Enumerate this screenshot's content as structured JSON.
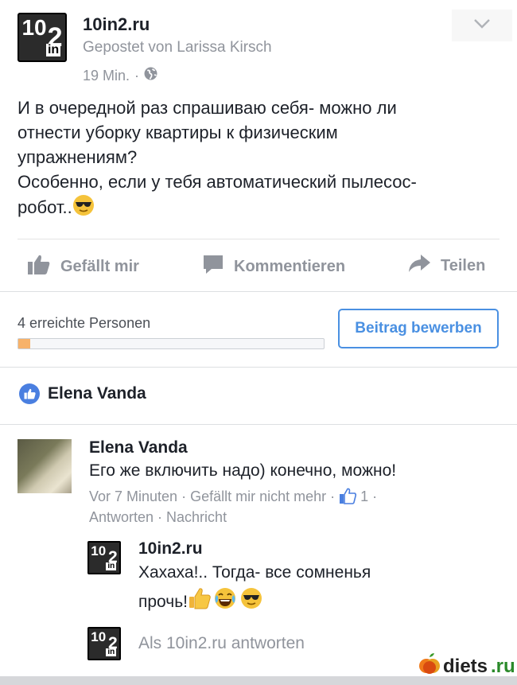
{
  "post": {
    "page_name": "10in2.ru",
    "posted_by": "Gepostet von Larissa Kirsch",
    "time": "19 Min.",
    "separator": "·",
    "text_lines": [
      "И в очередной раз спрашиваю себя- можно ли",
      "отнести уборку квартиры к физическим",
      "упражнениям?",
      "Особенно, если у тебя автоматический пылесос-",
      "робот.."
    ]
  },
  "actions": {
    "like": "Gefällt mir",
    "comment": "Kommentieren",
    "share": "Teilen"
  },
  "reach": {
    "label": "4 erreichte Personen",
    "progress_percent": 4,
    "boost_button": "Beitrag bewerben"
  },
  "likers": {
    "name": "Elena Vanda"
  },
  "comments": [
    {
      "author": "Elena Vanda",
      "text": "Его же включить надо) конечно, можно!",
      "meta_line1": "Vor 7 Minuten · Gefällt mir nicht mehr ·",
      "like_count": "1",
      "meta_trailing": "·",
      "meta_line2": "Antworten · Nachricht"
    },
    {
      "author": "10in2.ru",
      "text_line1": "Хахаха!.. Тогда- все сомненья",
      "text_line2": "прочь!"
    }
  ],
  "reply": {
    "placeholder": "Als 10in2.ru antworten"
  },
  "logo": {
    "top": "10",
    "mid": "in",
    "bottom": "2"
  },
  "watermark": {
    "text": "diets",
    "suffix": ".ru"
  },
  "colors": {
    "accent_blue": "#4a90e2",
    "like_blue": "#4a7fe0",
    "muted_gray": "#90949c",
    "progress_fill": "#f7b26a"
  },
  "icons": [
    "chevron-down-icon",
    "globe-icon",
    "thumbs-up-icon",
    "comment-icon",
    "share-icon",
    "like-badge-icon",
    "sunglasses-emoji",
    "thumbs-up-emoji",
    "laughing-tears-emoji",
    "apple-logo-icon"
  ]
}
